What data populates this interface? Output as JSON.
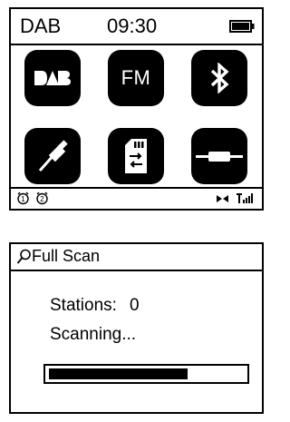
{
  "home": {
    "status": {
      "mode": "DAB",
      "time": "09:30"
    },
    "sources": [
      {
        "id": "dab",
        "label": "DAB",
        "icon": "dab-logo-icon"
      },
      {
        "id": "fm",
        "label": "FM",
        "icon": "fm-label-icon"
      },
      {
        "id": "bluetooth",
        "label": "",
        "icon": "bluetooth-icon"
      },
      {
        "id": "usb",
        "label": "",
        "icon": "usb-cable-icon"
      },
      {
        "id": "sd",
        "label": "",
        "icon": "sd-card-icon"
      },
      {
        "id": "aux",
        "label": "",
        "icon": "aux-cable-icon"
      }
    ],
    "footer": {
      "alarm1_label": "1",
      "alarm2_label": "2"
    }
  },
  "scan": {
    "title": "Full Scan",
    "stations_label": "Stations:",
    "stations_count": "0",
    "status_text": "Scanning...",
    "progress_fraction": 0.71
  }
}
